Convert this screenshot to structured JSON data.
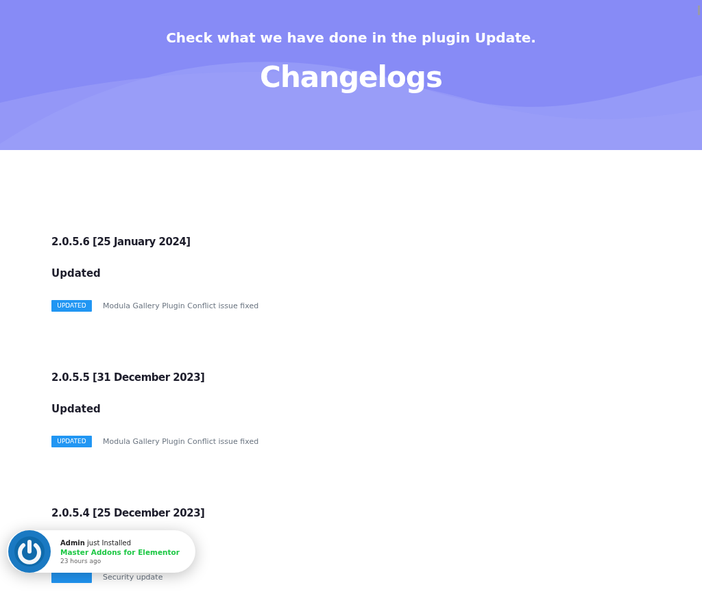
{
  "hero": {
    "subtitle": "Check what we have done in the plugin Update.",
    "title": "Changelogs"
  },
  "releases": [
    {
      "heading": "2.0.5.6 [25 January 2024]",
      "group": "Updated",
      "items": [
        {
          "tag": "UPDATED",
          "text": "Modula Gallery Plugin Conflict issue fixed"
        }
      ]
    },
    {
      "heading": "2.0.5.5 [31 December 2023]",
      "group": "Updated",
      "items": [
        {
          "tag": "UPDATED",
          "text": "Modula Gallery Plugin Conflict issue fixed"
        }
      ]
    },
    {
      "heading": "2.0.5.4 [25 December 2023]",
      "items": [
        {
          "text": "Security update"
        }
      ]
    }
  ],
  "notification": {
    "user": "Admin",
    "action": "just Installed",
    "product": "Master Addons for Elementor",
    "time": "23 hours ago"
  }
}
